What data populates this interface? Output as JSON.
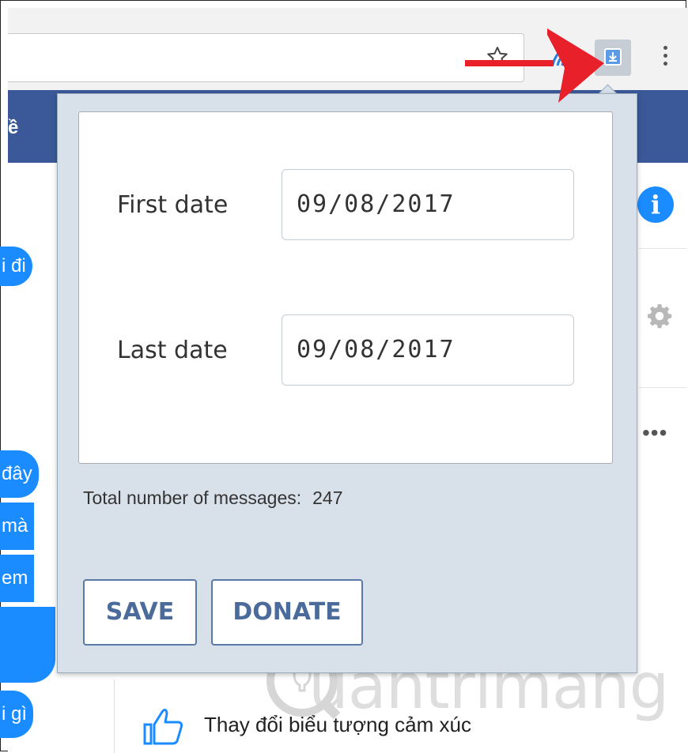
{
  "browser": {
    "extension_button": "download-extension",
    "arrow_color": "#e8202a"
  },
  "background_page": {
    "header_partial": "ề",
    "bubbles": [
      "i đi",
      "đây",
      "mà",
      "em",
      "i gì"
    ],
    "footer_action": "Thay đổi biểu tượng cảm xúc"
  },
  "popup": {
    "first_date_label": "First date",
    "first_date_value": "09/08/2017",
    "last_date_label": "Last date",
    "last_date_value": "09/08/2017",
    "total_label": "Total number of messages:",
    "total_value": "247",
    "save_label": "SAVE",
    "donate_label": "DONATE"
  },
  "watermark": {
    "text": "uantrimang"
  },
  "colors": {
    "facebook_blue": "#3b5998",
    "messenger_blue": "#1a8cff",
    "popup_bg": "#d8e0ea",
    "button_text": "#4b6b9a"
  }
}
